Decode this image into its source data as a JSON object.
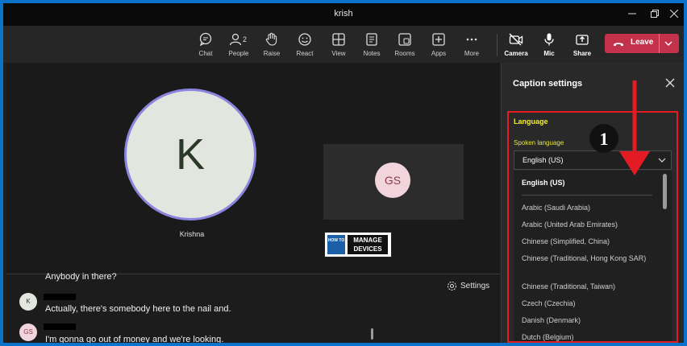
{
  "window": {
    "title": "krish"
  },
  "toolbar": {
    "items": [
      {
        "label": "Chat",
        "icon": "chat-icon"
      },
      {
        "label": "People",
        "icon": "people-icon",
        "count": "2"
      },
      {
        "label": "Raise",
        "icon": "hand-icon"
      },
      {
        "label": "React",
        "icon": "smiley-icon"
      },
      {
        "label": "View",
        "icon": "grid-icon"
      },
      {
        "label": "Notes",
        "icon": "notes-icon"
      },
      {
        "label": "Rooms",
        "icon": "rooms-icon"
      },
      {
        "label": "Apps",
        "icon": "plus-icon"
      },
      {
        "label": "More",
        "icon": "ellipsis-icon"
      }
    ],
    "camera_label": "Camera",
    "mic_label": "Mic",
    "share_label": "Share",
    "leave_label": "Leave",
    "leave_color": "#c4314b"
  },
  "stage": {
    "main_initial": "K",
    "main_name": "Krishna",
    "tile_initials": "GS",
    "logo": {
      "how": "HOW TO",
      "manage": "MANAGE",
      "devices": "DEVICES"
    }
  },
  "chat": {
    "settings_label": "Settings",
    "messages": [
      {
        "text": "Anybody in there?"
      },
      {
        "avatar": "K",
        "text": "Actually, there's somebody here to the nail and."
      },
      {
        "avatar": "GS",
        "text": "I'm gonna go out of money and we're looking."
      }
    ]
  },
  "panel": {
    "title": "Caption settings",
    "section_title": "Language",
    "spoken_label": "Spoken language",
    "selected": "English (US)",
    "list_selected": "English (US)",
    "options": [
      "Arabic (Saudi Arabia)",
      "Arabic (United Arab Emirates)",
      "Chinese (Simplified, China)",
      "Chinese (Traditional, Hong Kong SAR)",
      "Chinese (Traditional, Taiwan)",
      "Czech (Czechia)",
      "Danish (Denmark)",
      "Dutch (Belgium)"
    ],
    "marker": "1",
    "highlight_color": "#e31b23",
    "label_color": "#f1ef2b"
  }
}
